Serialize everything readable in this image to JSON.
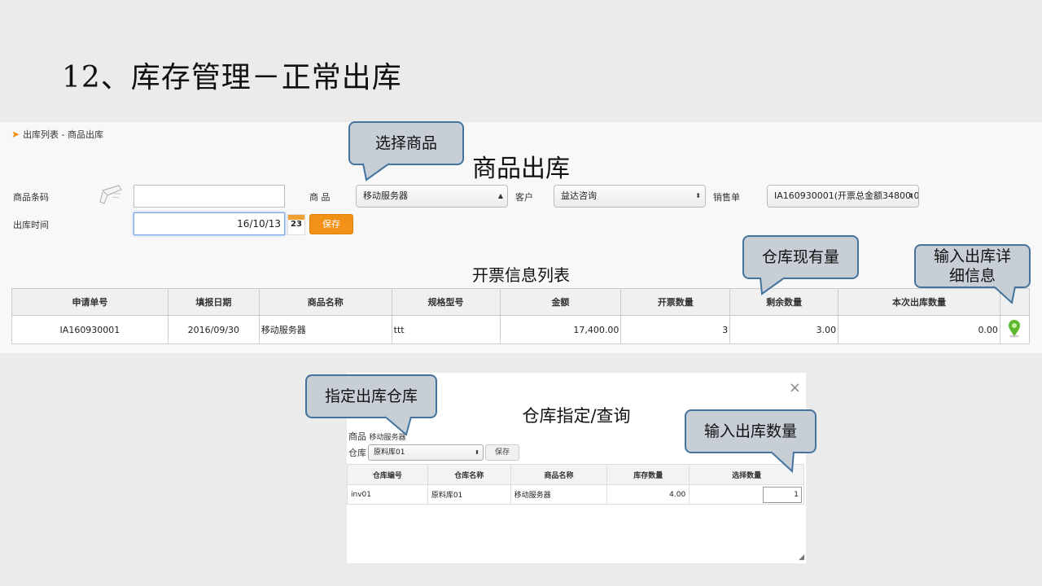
{
  "slide": {
    "title": "12、库存管理－正常出库"
  },
  "app": {
    "breadcrumb": "出库列表 - 商品出库",
    "heading": "商品出库",
    "form": {
      "barcode_label": "商品条码",
      "barcode_value": "",
      "product_label": "商 品",
      "product_value": "移动服务器",
      "customer_label": "客户",
      "customer_value": "益达咨询",
      "sales_order_label": "销售单",
      "sales_order_value": "IA160930001(开票总金额34800.0",
      "date_label": "出库时间",
      "date_value": "16/10/13",
      "calendar_day": "23",
      "save_label": "保存"
    },
    "invoice_list": {
      "title": "开票信息列表",
      "columns": [
        "申请单号",
        "填报日期",
        "商品名称",
        "规格型号",
        "金额",
        "开票数量",
        "剩余数量",
        "本次出库数量",
        ""
      ],
      "rows": [
        [
          "IA160930001",
          "2016/09/30",
          "移动服务器",
          "ttt",
          "17,400.00",
          "3",
          "3.00",
          "0.00"
        ]
      ]
    }
  },
  "callouts": {
    "select_product": "选择商品",
    "warehouse_stock": "仓库现有量",
    "input_details_line1": "输入出库详",
    "input_details_line2": "细信息",
    "specify_warehouse": "指定出库仓库",
    "input_quantity": "输入出库数量"
  },
  "modal": {
    "close": "×",
    "title": "仓库指定/查询",
    "product_label": "商品",
    "product_value": "移动服务器",
    "warehouse_label": "仓库",
    "warehouse_value": "原料库01",
    "save_label": "保存",
    "columns": [
      "仓库编号",
      "仓库名称",
      "商品名称",
      "库存数量",
      "选择数量"
    ],
    "rows": [
      [
        "inv01",
        "原料库01",
        "移动服务器",
        "4.00",
        "1"
      ]
    ]
  }
}
